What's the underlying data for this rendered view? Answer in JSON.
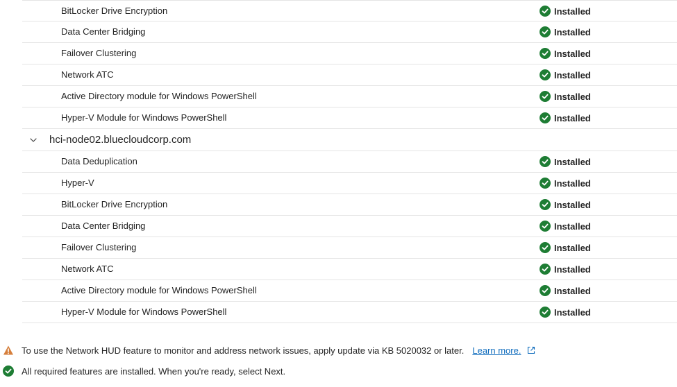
{
  "node1": {
    "features": [
      {
        "name": "BitLocker Drive Encryption",
        "status": "Installed"
      },
      {
        "name": "Data Center Bridging",
        "status": "Installed"
      },
      {
        "name": "Failover Clustering",
        "status": "Installed"
      },
      {
        "name": "Network ATC",
        "status": "Installed"
      },
      {
        "name": "Active Directory module for Windows PowerShell",
        "status": "Installed"
      },
      {
        "name": "Hyper-V Module for Windows PowerShell",
        "status": "Installed"
      }
    ]
  },
  "node2": {
    "name": "hci-node02.bluecloudcorp.com",
    "features": [
      {
        "name": "Data Deduplication",
        "status": "Installed"
      },
      {
        "name": "Hyper-V",
        "status": "Installed"
      },
      {
        "name": "BitLocker Drive Encryption",
        "status": "Installed"
      },
      {
        "name": "Data Center Bridging",
        "status": "Installed"
      },
      {
        "name": "Failover Clustering",
        "status": "Installed"
      },
      {
        "name": "Network ATC",
        "status": "Installed"
      },
      {
        "name": "Active Directory module for Windows PowerShell",
        "status": "Installed"
      },
      {
        "name": "Hyper-V Module for Windows PowerShell",
        "status": "Installed"
      }
    ]
  },
  "messages": {
    "warning_text": "To use the Network HUD feature to monitor and address network issues, apply update via KB 5020032 or later.",
    "learn_more": "Learn more.",
    "success_text": "All required features are installed. When you're ready, select Next."
  },
  "colors": {
    "success": "#1e7d34",
    "warning": "#d67f3c",
    "link": "#0f6cbd"
  },
  "icons": {
    "status": "check-circle-icon",
    "expand": "chevron-down-icon",
    "warning": "warning-icon",
    "external": "open-external-icon"
  }
}
